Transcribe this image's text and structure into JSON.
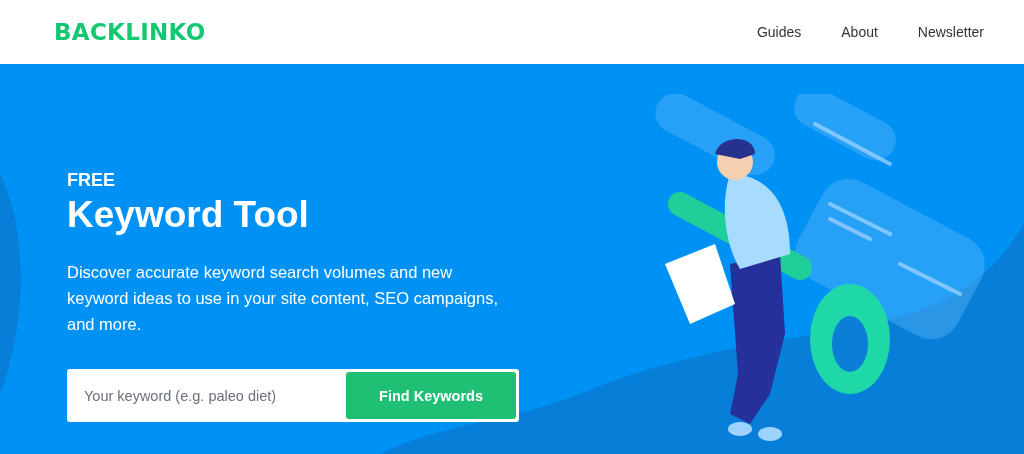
{
  "header": {
    "logo": "BACKLINKO",
    "nav": [
      "Guides",
      "About",
      "Newsletter"
    ]
  },
  "hero": {
    "eyebrow": "FREE",
    "title": "Keyword Tool",
    "description": "Discover accurate keyword search volumes and new keyword ideas to use in your site content, SEO campaigns, and more.",
    "search": {
      "placeholder": "Your keyword (e.g. paleo diet)"
    },
    "button": "Find Keywords"
  }
}
